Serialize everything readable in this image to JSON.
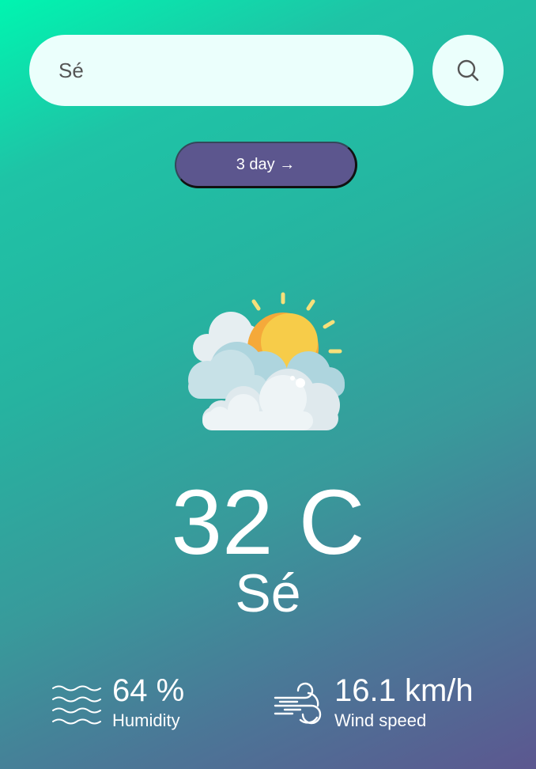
{
  "search": {
    "value": "Sé",
    "icon": "search-icon"
  },
  "forecast_button": {
    "label": "3 day →"
  },
  "weather": {
    "icon": "partly-cloudy-sun-icon",
    "temperature": "32 C",
    "city": "Sé"
  },
  "stats": {
    "humidity": {
      "icon": "water-waves-icon",
      "value": "64 %",
      "label": "Humidity"
    },
    "wind": {
      "icon": "wind-icon",
      "value": "16.1 km/h",
      "label": "Wind speed"
    }
  },
  "colors": {
    "gradient_start": "#00f5b0",
    "gradient_end": "#5c5790",
    "search_background": "#ebfffc",
    "button_background": "#5c568e",
    "text": "#ffffff"
  }
}
